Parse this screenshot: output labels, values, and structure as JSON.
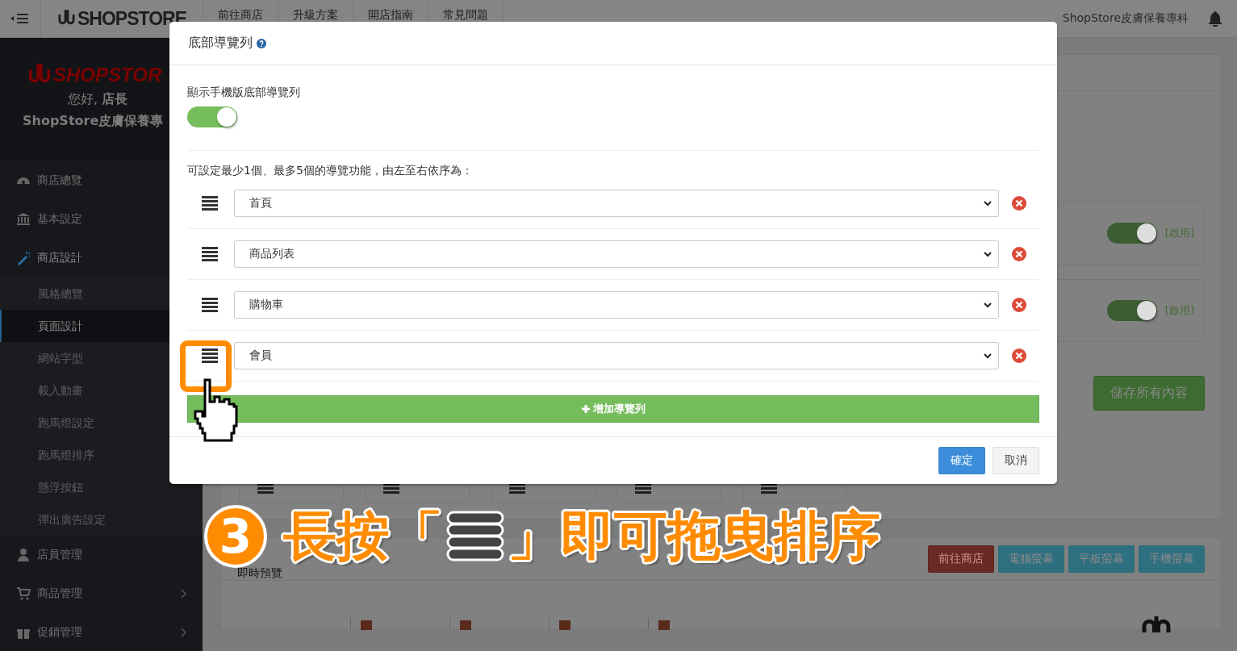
{
  "topbar": {
    "logo": "SHOPSTORE",
    "nav": [
      "前往商店",
      "升級方案",
      "開店指南",
      "常見問題"
    ],
    "store_name": "ShopStore皮膚保養專科"
  },
  "sidebar": {
    "logo": "SHOPSTOR",
    "greeting": "您好, **店長**",
    "store_name": "ShopStore皮膚保養專",
    "menu": [
      {
        "label": "商店總覽",
        "expanded": false
      },
      {
        "label": "基本設定",
        "expanded": false
      },
      {
        "label": "商店設計",
        "expanded": true,
        "children": [
          {
            "label": "風格總覽",
            "selected": false
          },
          {
            "label": "頁面設計",
            "selected": true
          },
          {
            "label": "網站字型",
            "selected": false
          },
          {
            "label": "載入動畫",
            "selected": false
          },
          {
            "label": "跑馬燈設定",
            "selected": false
          },
          {
            "label": "跑馬燈排序",
            "selected": false
          },
          {
            "label": "懸浮按鈕",
            "selected": false
          },
          {
            "label": "彈出廣告設定",
            "selected": false
          }
        ]
      },
      {
        "label": "店員管理",
        "expanded": false,
        "expandable": false
      },
      {
        "label": "商品管理",
        "expanded": false,
        "expandable": true
      },
      {
        "label": "促銷管理",
        "expanded": false,
        "expandable": true
      }
    ]
  },
  "main": {
    "panels": [
      {
        "on": true,
        "status": "[啟用]"
      },
      {
        "on": true,
        "status": "[啟用]"
      }
    ],
    "save_button": "儲存所有內容",
    "preview": {
      "title": "即時預覽",
      "buttons": [
        {
          "label": "前往商店",
          "kind": "danger"
        },
        {
          "label": "電腦螢幕",
          "kind": "info"
        },
        {
          "label": "平板螢幕",
          "kind": "info"
        },
        {
          "label": "手機螢幕",
          "kind": "info"
        }
      ]
    }
  },
  "modal": {
    "title": "底部導覽列",
    "toggle": {
      "label": "顯示手機版底部導覽列",
      "on": true
    },
    "description": "可設定最少1個、最多5個的導覽功能，由左至右依序為：",
    "items": [
      {
        "value": "首頁",
        "highlighted": false
      },
      {
        "value": "商品列表",
        "highlighted": false
      },
      {
        "value": "購物車",
        "highlighted": false
      },
      {
        "value": "會員",
        "highlighted": true
      }
    ],
    "add_button": "增加導覽列",
    "buttons": [
      {
        "label": "確定",
        "kind": "primary"
      },
      {
        "label": "取消",
        "kind": "default"
      }
    ]
  },
  "annotation": {
    "step": "3",
    "before": "長按「",
    "after": "」即可拖曳排序"
  }
}
